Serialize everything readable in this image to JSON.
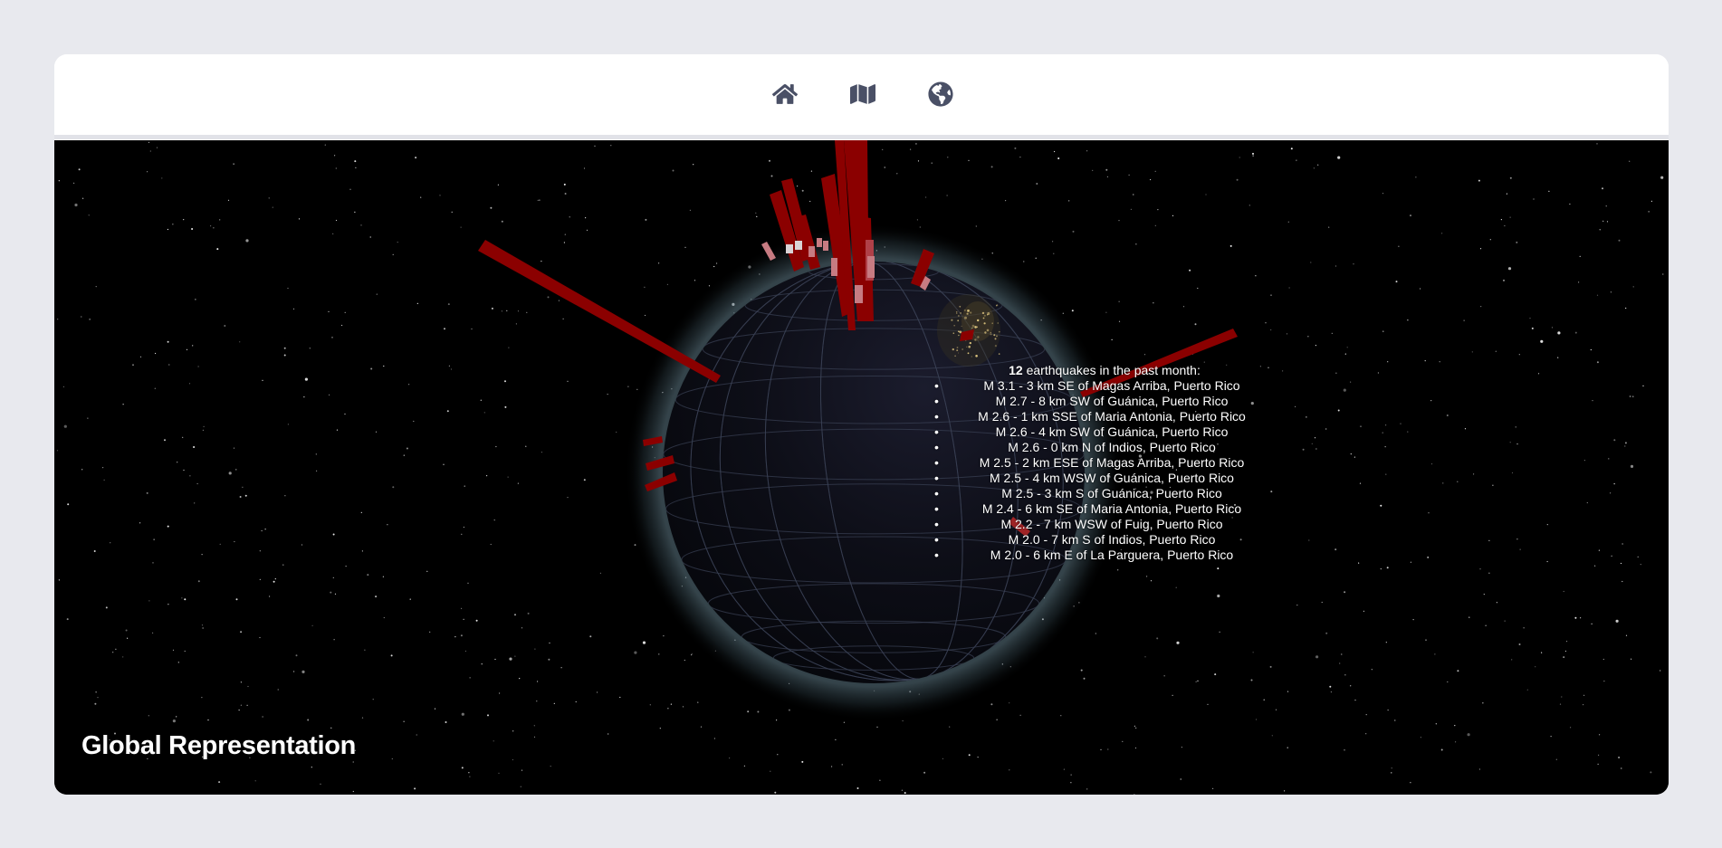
{
  "nav": {
    "items": [
      {
        "name": "home",
        "icon": "home-icon"
      },
      {
        "name": "map",
        "icon": "map-icon"
      },
      {
        "name": "globe",
        "icon": "globe-icon"
      }
    ]
  },
  "colors": {
    "background": "#e8e9ee",
    "card": "#ffffff",
    "icon": "#4a5066",
    "space": "#000000",
    "bar": "#8b0000",
    "bar_light": "#c77b82"
  },
  "summary": {
    "count": "12",
    "suffix": " earthquakes in the past month:"
  },
  "earthquakes": [
    "M 3.1 - 3 km SE of Magas Arriba, Puerto Rico",
    "M 2.7 - 8 km SW of Guánica, Puerto Rico",
    "M 2.6 - 1 km SSE of Maria Antonia, Puerto Rico",
    "M 2.6 - 4 km SW of Guánica, Puerto Rico",
    "M 2.6 - 0 km N of Indios, Puerto Rico",
    "M 2.5 - 2 km ESE of Magas Arriba, Puerto Rico",
    "M 2.5 - 4 km WSW of Guánica, Puerto Rico",
    "M 2.5 - 3 km S of Guánica, Puerto Rico",
    "M 2.4 - 6 km SE of Maria Antonia, Puerto Rico",
    "M 2.2 - 7 km WSW of Fuig, Puerto Rico",
    "M 2.0 - 7 km S of Indios, Puerto Rico",
    "M 2.0 - 6 km E of La Parguera, Puerto Rico"
  ],
  "title": "Global Representation"
}
